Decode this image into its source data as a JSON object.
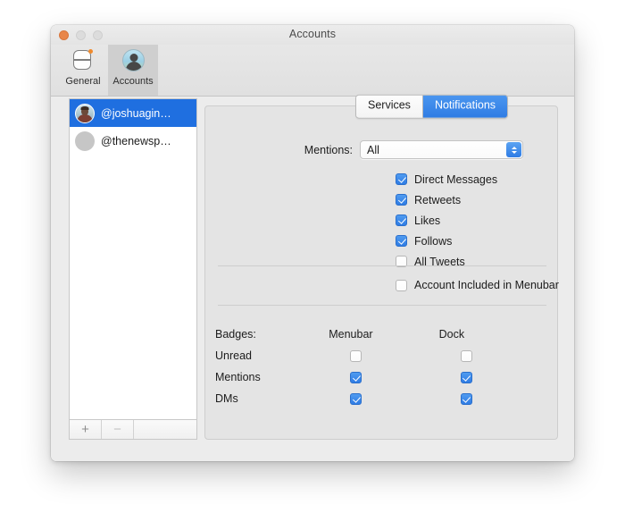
{
  "window": {
    "title": "Accounts",
    "traffic_lights": [
      "close",
      "minimize",
      "zoom"
    ]
  },
  "toolbar": {
    "items": [
      {
        "label": "General",
        "icon": "general-icon",
        "selected": false
      },
      {
        "label": "Accounts",
        "icon": "accounts-avatar-icon",
        "selected": true
      }
    ]
  },
  "sidebar": {
    "accounts": [
      {
        "name": "@joshuagin…",
        "avatar": "photo",
        "selected": true
      },
      {
        "name": "@thenewsp…",
        "avatar": "placeholder",
        "selected": false
      }
    ],
    "add_button": "+",
    "remove_button": "−"
  },
  "tabs": [
    {
      "label": "Services",
      "active": false
    },
    {
      "label": "Notifications",
      "active": true
    }
  ],
  "notifications": {
    "mentions": {
      "label": "Mentions:",
      "value": "All",
      "options": [
        "All"
      ]
    },
    "checkboxes": [
      {
        "label": "Direct Messages",
        "checked": true
      },
      {
        "label": "Retweets",
        "checked": true
      },
      {
        "label": "Likes",
        "checked": true
      },
      {
        "label": "Follows",
        "checked": true
      },
      {
        "label": "All Tweets",
        "checked": false
      }
    ],
    "menubar_option": {
      "label": "Account Included in Menubar",
      "checked": false
    },
    "badges": {
      "title": "Badges:",
      "columns": [
        "Menubar",
        "Dock"
      ],
      "rows": [
        {
          "label": "Unread",
          "menubar": false,
          "dock": false
        },
        {
          "label": "Mentions",
          "menubar": true,
          "dock": true
        },
        {
          "label": "DMs",
          "menubar": true,
          "dock": true
        }
      ]
    }
  },
  "colors": {
    "accent_blue": "#2f7ce4",
    "selection_blue": "#1f6fe0",
    "window_bg": "#ececec",
    "panel_bg": "#e4e4e4",
    "close_button": "#e8864a"
  }
}
